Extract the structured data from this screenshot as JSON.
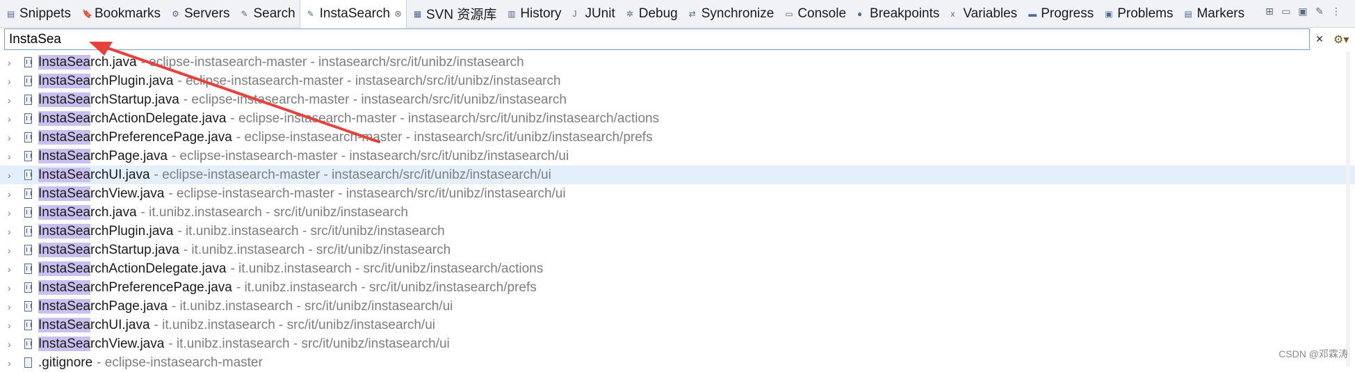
{
  "tabs": [
    {
      "label": "Snippets",
      "icon": "snippets-icon",
      "active": false
    },
    {
      "label": "Bookmarks",
      "icon": "bookmark-icon",
      "active": false
    },
    {
      "label": "Servers",
      "icon": "servers-icon",
      "active": false
    },
    {
      "label": "Search",
      "icon": "search-icon",
      "active": false
    },
    {
      "label": "InstaSearch",
      "icon": "instasearch-icon",
      "active": true
    },
    {
      "label": "SVN 资源库",
      "icon": "svn-icon",
      "active": false
    },
    {
      "label": "History",
      "icon": "history-icon",
      "active": false
    },
    {
      "label": "JUnit",
      "icon": "junit-icon",
      "active": false
    },
    {
      "label": "Debug",
      "icon": "debug-icon",
      "active": false
    },
    {
      "label": "Synchronize",
      "icon": "synchronize-icon",
      "active": false
    },
    {
      "label": "Console",
      "icon": "console-icon",
      "active": false
    },
    {
      "label": "Breakpoints",
      "icon": "breakpoints-icon",
      "active": false
    },
    {
      "label": "Variables",
      "icon": "variables-icon",
      "active": false
    },
    {
      "label": "Progress",
      "icon": "progress-icon",
      "active": false
    },
    {
      "label": "Problems",
      "icon": "problems-icon",
      "active": false
    },
    {
      "label": "Markers",
      "icon": "markers-icon",
      "active": false
    }
  ],
  "search": {
    "value": "InstaSea",
    "clear_glyph": "×",
    "match": "InstaSea"
  },
  "results": [
    {
      "name": "InstaSearch.java",
      "desc": "- eclipse-instasearch-master - instasearch/src/it/unibz/instasearch"
    },
    {
      "name": "InstaSearchPlugin.java",
      "desc": "- eclipse-instasearch-master - instasearch/src/it/unibz/instasearch"
    },
    {
      "name": "InstaSearchStartup.java",
      "desc": "- eclipse-instasearch-master - instasearch/src/it/unibz/instasearch"
    },
    {
      "name": "InstaSearchActionDelegate.java",
      "desc": "- eclipse-instasearch-master - instasearch/src/it/unibz/instasearch/actions"
    },
    {
      "name": "InstaSearchPreferencePage.java",
      "desc": "- eclipse-instasearch-master - instasearch/src/it/unibz/instasearch/prefs"
    },
    {
      "name": "InstaSearchPage.java",
      "desc": "- eclipse-instasearch-master - instasearch/src/it/unibz/instasearch/ui"
    },
    {
      "name": "InstaSearchUI.java",
      "desc": "- eclipse-instasearch-master - instasearch/src/it/unibz/instasearch/ui",
      "selected": true
    },
    {
      "name": "InstaSearchView.java",
      "desc": "- eclipse-instasearch-master - instasearch/src/it/unibz/instasearch/ui"
    },
    {
      "name": "InstaSearch.java",
      "desc": "- it.unibz.instasearch - src/it/unibz/instasearch"
    },
    {
      "name": "InstaSearchPlugin.java",
      "desc": "- it.unibz.instasearch - src/it/unibz/instasearch"
    },
    {
      "name": "InstaSearchStartup.java",
      "desc": "- it.unibz.instasearch - src/it/unibz/instasearch"
    },
    {
      "name": "InstaSearchActionDelegate.java",
      "desc": "- it.unibz.instasearch - src/it/unibz/instasearch/actions"
    },
    {
      "name": "InstaSearchPreferencePage.java",
      "desc": "- it.unibz.instasearch - src/it/unibz/instasearch/prefs"
    },
    {
      "name": "InstaSearchPage.java",
      "desc": "- it.unibz.instasearch - src/it/unibz/instasearch/ui"
    },
    {
      "name": "InstaSearchUI.java",
      "desc": "- it.unibz.instasearch - src/it/unibz/instasearch/ui"
    },
    {
      "name": "InstaSearchView.java",
      "desc": "- it.unibz.instasearch - src/it/unibz/instasearch/ui"
    },
    {
      "name": ".gitignore",
      "desc": "- eclipse-instasearch-master",
      "plain": true
    }
  ],
  "watermark": "CSDN @邓霖涛",
  "colors": {
    "highlight": "#c9c0ef",
    "selected_row": "#e3effb",
    "arrow": "#e8403a"
  }
}
